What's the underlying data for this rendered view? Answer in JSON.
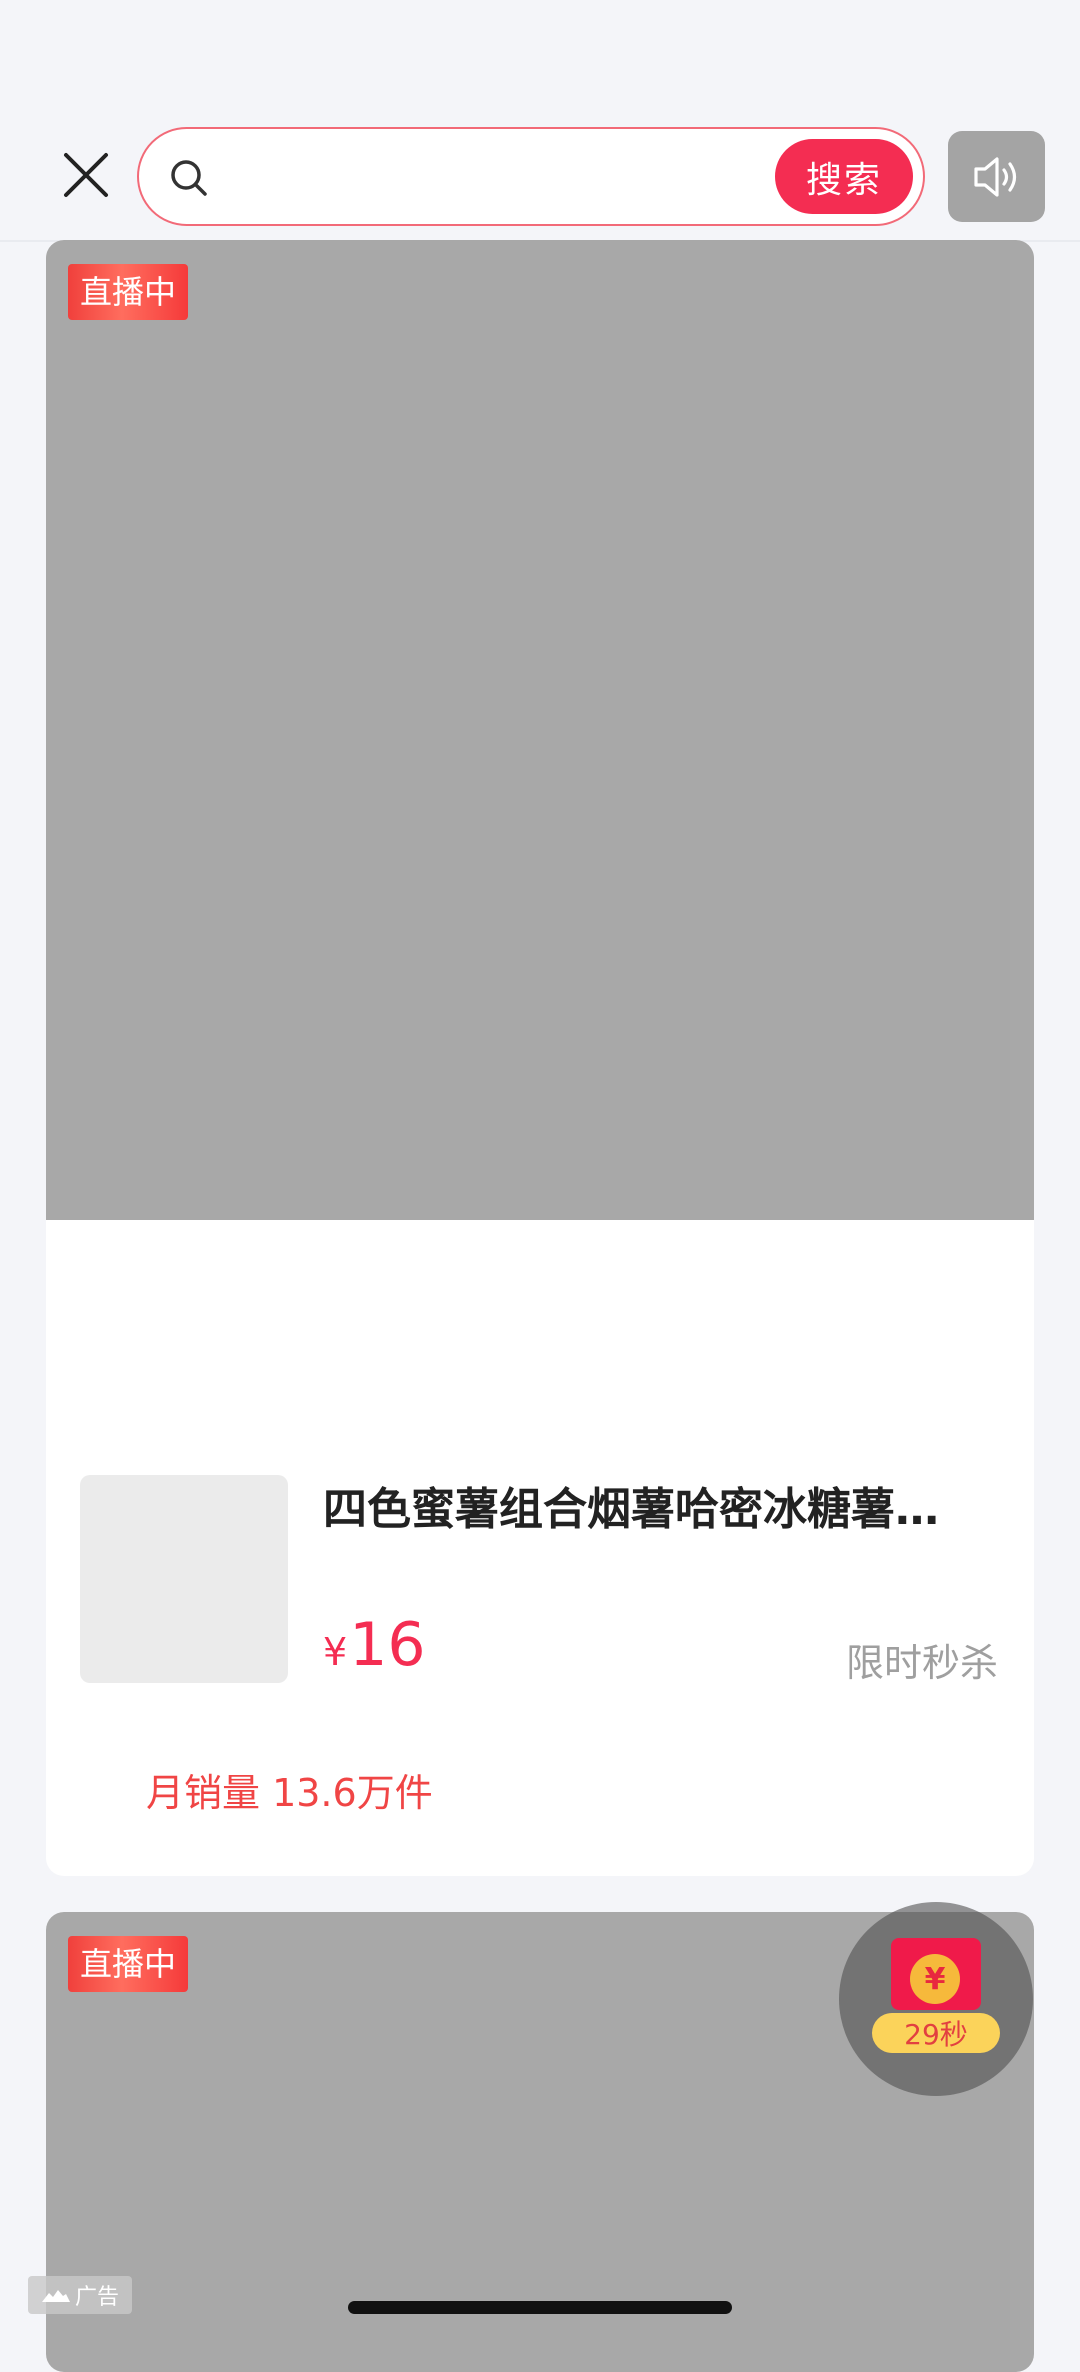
{
  "header": {
    "close_icon": "close-icon",
    "search": {
      "icon": "search-icon",
      "value": "",
      "placeholder": "",
      "button_label": "搜索"
    },
    "sound_icon": "speaker-icon"
  },
  "cards": [
    {
      "badge": "直播中",
      "product": {
        "title": "四色蜜薯组合烟薯哈密冰糖薯…",
        "currency": "¥",
        "price": "16",
        "promo": "限时秒杀",
        "monthly_sales": "月销量 13.6万件"
      }
    },
    {
      "badge": "直播中"
    }
  ],
  "red_packet": {
    "coin_symbol": "¥",
    "timer": "29秒"
  },
  "ad_label": "广告",
  "colors": {
    "accent": "#f42d52",
    "background": "#f4f5f9",
    "media_placeholder": "#a8a8a8"
  }
}
